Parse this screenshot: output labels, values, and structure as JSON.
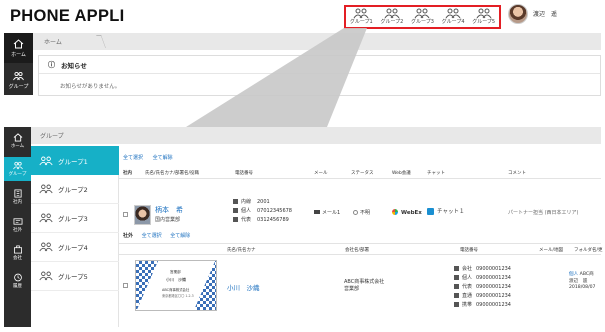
{
  "header": {
    "brand": "PHONE APPLI",
    "groups": [
      "グループ1",
      "グループ2",
      "グループ3",
      "グループ4",
      "グループ5"
    ],
    "user_name": "渡辺　遥",
    "highlight_color": "#e31e24"
  },
  "top_window": {
    "sidebar": [
      {
        "label": "ホーム",
        "icon": "home-icon"
      },
      {
        "label": "グループ",
        "icon": "group-icon"
      }
    ],
    "breadcrumb": "ホーム",
    "panel_title": "お知らせ",
    "panel_body": "お知らせがありません。"
  },
  "bottom_window": {
    "sidebar": [
      {
        "label": "ホーム",
        "icon": "home-icon"
      },
      {
        "label": "グループ",
        "icon": "group-icon"
      },
      {
        "label": "社内",
        "icon": "building-icon"
      },
      {
        "label": "社外",
        "icon": "card-icon"
      },
      {
        "label": "会社",
        "icon": "office-icon"
      },
      {
        "label": "履歴",
        "icon": "history-icon"
      }
    ],
    "breadcrumb": "グループ",
    "group_list": [
      "グループ1",
      "グループ2",
      "グループ3",
      "グループ4",
      "グループ5"
    ],
    "select_all": "全て選択",
    "deselect_all": "全て解除",
    "internal": {
      "tab": "社内",
      "columns": [
        "氏名/氏名カナ/部署名/役職",
        "電話番号",
        "メール",
        "ステータス",
        "Web会議",
        "チャット",
        "コメント"
      ],
      "row": {
        "name": "柄本　希",
        "dept": "国内営業部",
        "phones": [
          {
            "label": "内線",
            "value": "2001"
          },
          {
            "label": "個人",
            "value": "07012345678"
          },
          {
            "label": "代表",
            "value": "0312456789"
          }
        ],
        "mail": "メール1",
        "status": "不明",
        "web": "WebEx",
        "chat": "チャット１",
        "comment": "パートナー担当 (西日本エリア)"
      }
    },
    "external": {
      "tab": "社外",
      "columns": [
        "氏名/氏名カナ",
        "会社名/部署",
        "電話番号",
        "メール/地図",
        "フォルダ名/更"
      ],
      "row": {
        "name": "小川　沙織",
        "company": "ABC商事株式会社",
        "dept": "営業部",
        "phones": [
          {
            "label": "会社",
            "value": "09000001234"
          },
          {
            "label": "個人",
            "value": "09000001234"
          },
          {
            "label": "代表",
            "value": "09000001234"
          },
          {
            "label": "直通",
            "value": "09000001234"
          },
          {
            "label": "携帯",
            "value": "09000001234"
          }
        ],
        "folder_prefix": "個人",
        "folder_company": "ABC商",
        "folder_person": "渡辺　遥",
        "updated": "2018/08/07"
      },
      "card": {
        "title": "営業部",
        "name": "小川　沙織",
        "company": "ABC商事株式会社",
        "address": "東京都港区〇〇 1-2-3"
      }
    }
  }
}
